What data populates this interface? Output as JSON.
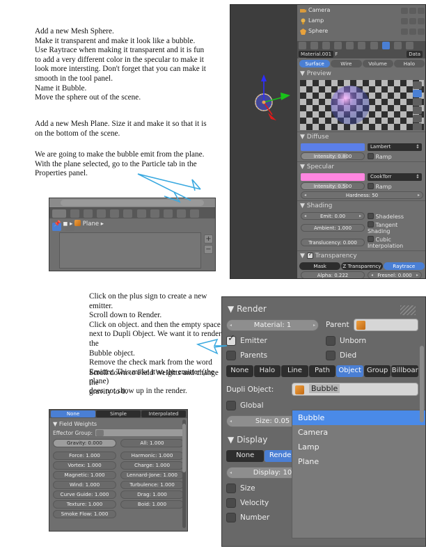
{
  "instructions": {
    "top": "Add a new Mesh Sphere.\nMake it transparent and make it look like a bubble.\nUse Raytrace when making it transparent and it is fun\nto add a very different color in the specular to make it\nlook more intersting. Don't forget that you can make it\nsmooth in the tool panel.\nName it Bubble.\nMove the sphere out of the scene.",
    "mid": "Add a new Mesh Plane. Size it and make it so that it is\non the bottom of the scene.",
    "mid2": "We are going to make the bubble emit from the plane.\nWith the plane selected, go to the Particle tab in the\nProperties panel.",
    "low": "Click on the plus sign to create a new emitter.\nScroll down to Render.\nClick on object. and then the empty space\nnext to Dupli Object. We want it to render the\nBubble object.\nRemove the check mark from the word\nEmitter. This make it so the emitter (the plane)\ndoes not show up in the render.",
    "low2": "Scroll down to Field Weights and change the\ngravity to 0."
  },
  "outliner": {
    "rows": [
      {
        "label": "Camera",
        "icon": "camera-icon"
      },
      {
        "label": "Lamp",
        "icon": "lamp-icon"
      },
      {
        "label": "Sphere",
        "icon": "mesh-icon"
      }
    ]
  },
  "material_panel": {
    "id_field": "Material.001",
    "f_label": "F",
    "data_label": "Data",
    "shader_tabs": [
      {
        "label": "Surface",
        "selected": true
      },
      {
        "label": "Wire",
        "selected": false
      },
      {
        "label": "Volume",
        "selected": false
      },
      {
        "label": "Halo",
        "selected": false
      }
    ],
    "preview_header": "Preview",
    "diffuse": {
      "header": "Diffuse",
      "color": "#5b7fe8",
      "shader": "Lambert",
      "intensity": "Intensity: 0.800",
      "ramp": "Ramp"
    },
    "specular": {
      "header": "Specular",
      "color": "#ff86e0",
      "shader": "CookTorr",
      "intensity": "Intensity: 0.500",
      "ramp": "Ramp",
      "hardness": "Hardness: 50"
    },
    "shading": {
      "header": "Shading",
      "emit": "Emit: 0.00",
      "ambient": "Ambient: 1.000",
      "translucency": "Translucency: 0.000",
      "shadeless": "Shadeless",
      "tangent": "Tangent Shading",
      "cubic": "Cubic Interpolation"
    },
    "transparency": {
      "header": "Transparency",
      "modes": [
        {
          "label": "Mask",
          "selected": false
        },
        {
          "label": "Z Transparency",
          "selected": false
        },
        {
          "label": "Raytrace",
          "selected": true
        }
      ],
      "alpha": "Alpha: 0.222",
      "fresnel": "Fresnel: 0.000"
    }
  },
  "particle_tab_shot": {
    "breadcrumb": "Plane",
    "plus_label": "+",
    "minus_label": "−"
  },
  "field_weights": {
    "tabs": [
      {
        "label": "None",
        "selected": true
      },
      {
        "label": "Simple",
        "selected": false
      },
      {
        "label": "Interpolated",
        "selected": false
      }
    ],
    "header": "Field Weights",
    "effector_label": "Effector Group:",
    "effector_value": "",
    "fields": [
      {
        "label": "Gravity: 0.000",
        "highlight": true
      },
      {
        "label": "All: 1.000",
        "highlight": false
      },
      {
        "label": "Force: 1.000",
        "highlight": false
      },
      {
        "label": "Harmonic: 1.000",
        "highlight": false
      },
      {
        "label": "Vortex: 1.000",
        "highlight": false
      },
      {
        "label": "Charge: 1.000",
        "highlight": false
      },
      {
        "label": "Magnetic: 1.000",
        "highlight": false
      },
      {
        "label": "Lennard-Jone: 1.000",
        "highlight": false
      },
      {
        "label": "Wind: 1.000",
        "highlight": false
      },
      {
        "label": "Turbulence: 1.000",
        "highlight": false
      },
      {
        "label": "Curve Guide: 1.000",
        "highlight": false
      },
      {
        "label": "Drag: 1.000",
        "highlight": false
      },
      {
        "label": "Texture: 1.000",
        "highlight": false
      },
      {
        "label": "Boid: 1.000",
        "highlight": false
      },
      {
        "label": "Smoke Flow: 1.000",
        "highlight": false
      }
    ]
  },
  "render_panel": {
    "header": "Render",
    "material": "Material: 1",
    "parent_label": "Parent",
    "parent_value": "",
    "checkboxes": [
      {
        "label": "Emitter",
        "checked": true
      },
      {
        "label": "Unborn",
        "checked": false
      },
      {
        "label": "Parents",
        "checked": false
      },
      {
        "label": "Died",
        "checked": false
      }
    ],
    "render_type_tabs": [
      {
        "label": "None",
        "selected": false
      },
      {
        "label": "Halo",
        "selected": false
      },
      {
        "label": "Line",
        "selected": false
      },
      {
        "label": "Path",
        "selected": false
      },
      {
        "label": "Object",
        "selected": true
      },
      {
        "label": "Group",
        "selected": false
      },
      {
        "label": "Billboar",
        "selected": false
      }
    ],
    "dupli_label": "Dupli Object:",
    "dupli_value": "Bubble",
    "global_label": "Global",
    "size_label": "Size: 0.05",
    "dropdown_items": [
      {
        "label": "Bubble",
        "selected": true
      },
      {
        "label": "Camera",
        "selected": false
      },
      {
        "label": "Lamp",
        "selected": false
      },
      {
        "label": "Plane",
        "selected": false
      }
    ],
    "display": {
      "header": "Display",
      "tabs": [
        {
          "label": "None",
          "selected": false
        },
        {
          "label": "Rendere",
          "selected": true
        }
      ],
      "display_value": "Display: 10",
      "options": [
        {
          "label": "Size",
          "checked": false
        },
        {
          "label": "Velocity",
          "checked": false
        },
        {
          "label": "Number",
          "checked": false
        }
      ]
    }
  },
  "annotation_color": "#3aa9e0"
}
